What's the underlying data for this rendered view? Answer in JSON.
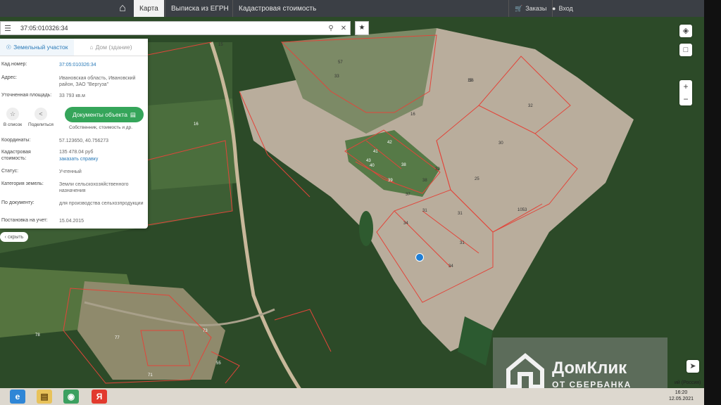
{
  "nav": {
    "map": "Карта",
    "egrn": "Выписка из ЕГРН",
    "cadastral": "Кадастровая стоимость",
    "orders": "Заказы",
    "login": "Вход"
  },
  "search": {
    "value": "37:05:010326:34"
  },
  "tabs": {
    "land": "Земельный участок",
    "house": "Дом (здание)"
  },
  "info": {
    "cad_label": "Кад.номер:",
    "cad_value": "37:05:010326:34",
    "addr_label": "Адрес:",
    "addr_value": "Ивановская область, Ивановский район, ЗАО \"Вергуза\"",
    "area_label": "Уточненная площадь:",
    "area_value": "33 793 кв.м",
    "coords_label": "Координаты:",
    "coords_value": "57.123650, 40.756273",
    "cost_label": "Кадастровая стоимость:",
    "cost_value": "135 478.04 руб",
    "cost_link": "заказать справку",
    "status_label": "Статус:",
    "status_value": "Учтенный",
    "category_label": "Категория земель:",
    "category_value": "Земли сельскохозяйственного назначения",
    "usage_label": "По документу:",
    "usage_value": "для производства сельхозпродукции",
    "reg_label": "Постановка на учет:",
    "reg_value": "15.04.2015"
  },
  "actions": {
    "list": "В список",
    "share": "Поделиться",
    "docs": "Документы объекта",
    "docs_sub": "Собственник, стоимость и др."
  },
  "hide": "скрыть",
  "parcels": [
    "16",
    "15",
    "16",
    "15",
    "56",
    "32",
    "30",
    "25",
    "1053",
    "31",
    "31",
    "34",
    "31",
    "34",
    "37",
    "38",
    "38",
    "39",
    "40",
    "41",
    "42",
    "43",
    "32",
    "33",
    "77",
    "78",
    "73",
    "55",
    "71",
    "57"
  ],
  "watermark": {
    "title": "ДомКлик",
    "subtitle": "ОТ СБЕРБАНКА"
  },
  "tray": {
    "lang": "ий (Россия)",
    "time": "16:20",
    "date": "12.05.2021"
  },
  "icons": [
    "home-icon",
    "cart-icon",
    "user-icon",
    "menu-icon",
    "search-icon",
    "close-icon",
    "star-icon",
    "layers-icon",
    "square-icon",
    "zoom-in-icon",
    "zoom-out-icon",
    "locate-icon",
    "ie-icon",
    "folder-icon",
    "chrome-icon",
    "yandex-icon"
  ]
}
